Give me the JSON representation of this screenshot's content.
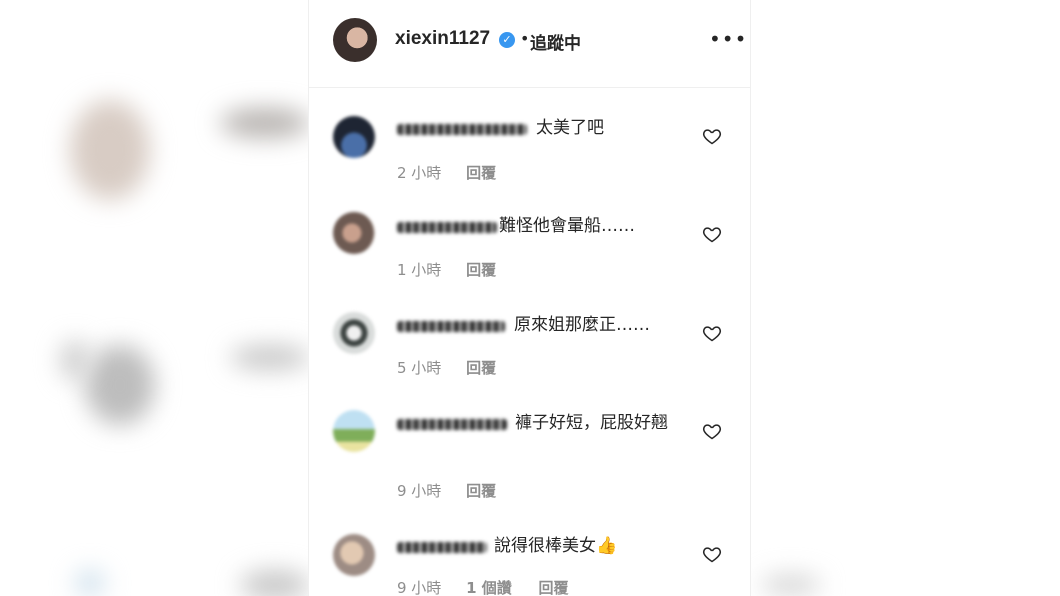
{
  "header": {
    "username": "xiexin1127",
    "separator": "•",
    "follow_status": "追蹤中"
  },
  "comments": [
    {
      "text": "太美了吧",
      "time": "2 小時",
      "reply": "回覆"
    },
    {
      "text": "難怪他會暈船……",
      "time": "1 小時",
      "reply": "回覆"
    },
    {
      "text": "原來姐那麼正……",
      "time": "5 小時",
      "reply": "回覆"
    },
    {
      "text": "褲子好短，屁股好翹",
      "time": "9 小時",
      "reply": "回覆"
    },
    {
      "text": "說得很棒美女👍",
      "time": "9 小時",
      "likes": "1 個讚",
      "reply": "回覆"
    }
  ],
  "icons": {
    "verified": "verified-badge-icon",
    "more": "more-options-icon",
    "like": "heart-icon"
  },
  "colors": {
    "accent": "#3897f0",
    "meta_text": "#8e8e8e",
    "body_text": "#262626"
  }
}
